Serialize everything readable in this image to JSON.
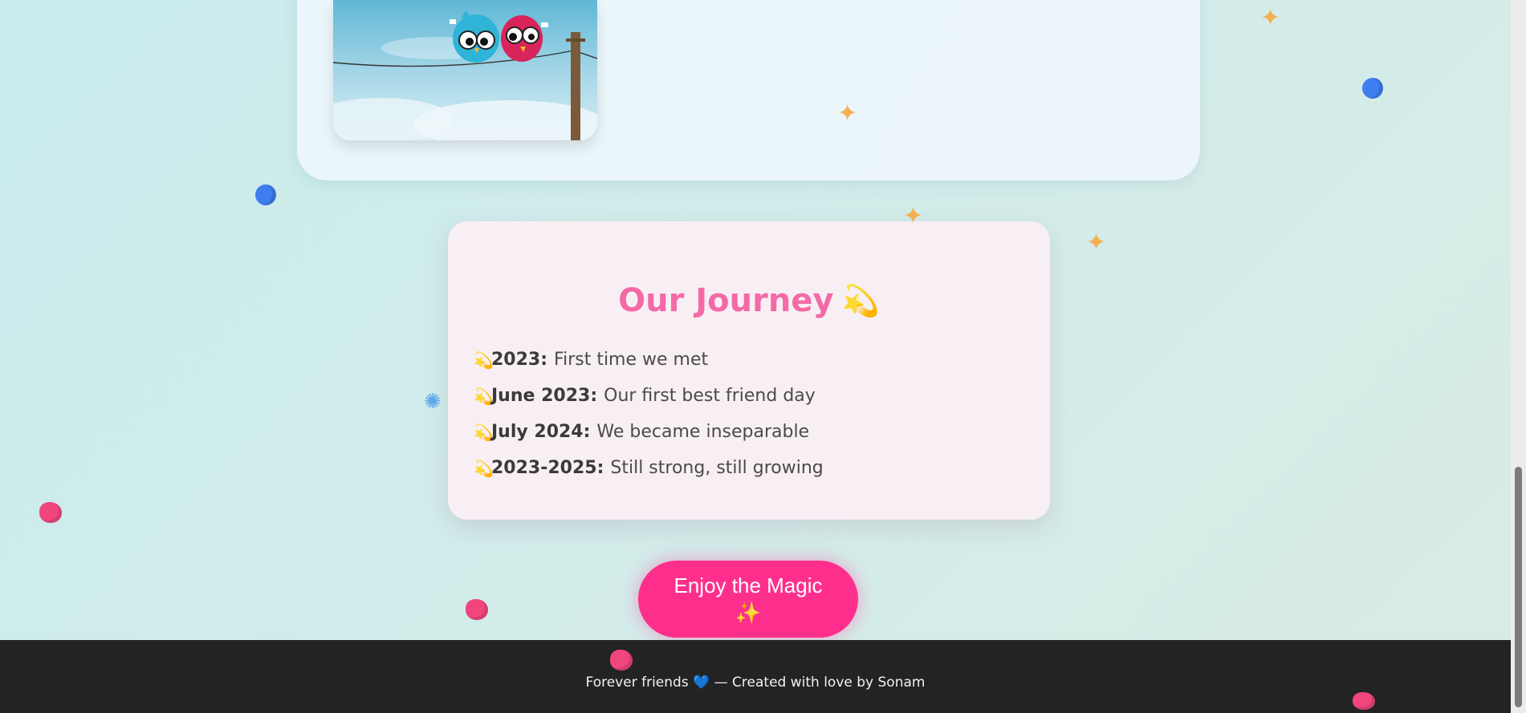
{
  "journey": {
    "title": "Our Journey",
    "title_emoji": "💫",
    "bullet": "💫",
    "items": [
      {
        "date": "2023:",
        "text": "First time we met"
      },
      {
        "date": "June 2023:",
        "text": "Our first best friend day"
      },
      {
        "date": "July 2024:",
        "text": "We became inseparable"
      },
      {
        "date": "2023-2025:",
        "text": "Still strong, still growing"
      }
    ]
  },
  "button": {
    "label": "Enjoy the Magic",
    "emoji": "✨"
  },
  "footer": {
    "text_before": "Forever friends",
    "heart": "💙",
    "text_after": "— Created with love by Sonam"
  },
  "colors": {
    "accent_pink": "#fe2f8c",
    "title_pink": "#f36aa7",
    "footer_bg": "#232323"
  },
  "icons": [
    "sparkles-icon",
    "blue-heart-icon",
    "pink-heart-icon",
    "party-popper-icon",
    "dizzy-icon"
  ]
}
